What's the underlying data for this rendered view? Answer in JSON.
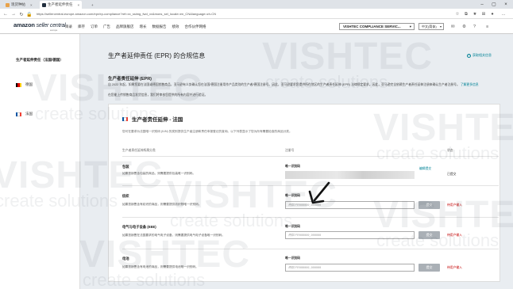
{
  "browser": {
    "tabs": [
      {
        "label": "现货种帖"
      },
      {
        "label": "生产者延伸责任"
      }
    ],
    "url": "https://sellercentral-europe.amazon.com/epr/ep-compliance?ref=xx_ssimg_fwd_xx&mons_sel_locale=en_CN&language=zh-CN"
  },
  "header": {
    "logo_main": "amazon",
    "logo_sc": "seller central",
    "logo_sub": "europe",
    "nav": [
      "目录",
      "库存",
      "订单",
      "广告",
      "品牌旗舰店",
      "增长",
      "数据报告",
      "绩效",
      "合作伙伴网络"
    ],
    "account": "VISHTEC COMPLIANCE SERVIC...",
    "language": "中文(简体)"
  },
  "sidebar": {
    "title": "生产者延伸责任（法国/德国）",
    "items": [
      {
        "label": "德国",
        "flag": [
          "#000000",
          "#dd0000",
          "#ffce00"
        ]
      },
      {
        "label": "法国",
        "flag": [
          "#0055a4",
          "#ffffff",
          "#ef4135"
        ]
      }
    ]
  },
  "main": {
    "title": "生产者延伸责任 (EPR) 的合规信息",
    "help": "获取相关信息",
    "section_heading": "生产者责任延伸 (EPR)",
    "description": "自 2022 年起，如果您要在法国或德国销售商品，亚马逊有义务确认您在法国/德国注册用作产品类别的生产者/德国注册号。因此，亚马逊要求您提供所在地区的生产者责任延伸 (EPR) 法律规定要求。因此，亚马逊完全依赖生产者责任延伸注册来确认生产者注册号。",
    "description_link": "了解更多信息",
    "description2": "在您能上传销售商品发货信息，我们将审核您提供的所有内容并进行验证。",
    "card": {
      "title": "生产者责任延伸 - 法国",
      "subtitle": "您可在要求为法国唯一识别码 (IUN) 的类别提供生产者注册和责任申报登记的查询。以下列表显示了您为所有需要检查的商品分类。",
      "col_category": "生产者责任延伸所属分类",
      "col_reg": "注册号",
      "col_status": "状态",
      "rows": [
        {
          "title": "包装",
          "desc": "如果您销售含包装的商品，则需要提供包装唯一识别码。",
          "reg_label": "唯一识别码",
          "update": "编辑提交",
          "status": "已提交",
          "filled": true
        },
        {
          "title": "纺织",
          "desc": "如果您销售含有纺织的商品，则需要提供纺织物唯一识别码。",
          "reg_label": "唯一识别码",
          "placeholder": "例如 FR999999_999999",
          "button": "提交",
          "status": "待用户输入",
          "filled": false
        },
        {
          "title": "电气与电子设备 (EEE)",
          "desc": "如果您销售在法国要求的电气电子设备，则需要提供电气电子设备唯一识别码。",
          "reg_label": "唯一识别码",
          "placeholder": "例如 FR999999_999999",
          "button": "提交",
          "status": "待用户输入",
          "filled": false
        },
        {
          "title": "电池",
          "desc": "如果您销售含有电池的商品，则需要提供电池唯一识别码。",
          "reg_label": "唯一识别码",
          "placeholder": "例如 FR999999_999999",
          "button": "提交",
          "status": "待用户输入",
          "filled": false
        }
      ]
    }
  },
  "watermark": {
    "big": "VISHTEC",
    "small": "create solutions"
  },
  "colors": {
    "accent": "#008296",
    "required": "#c40000",
    "button": "#aab0b6"
  }
}
